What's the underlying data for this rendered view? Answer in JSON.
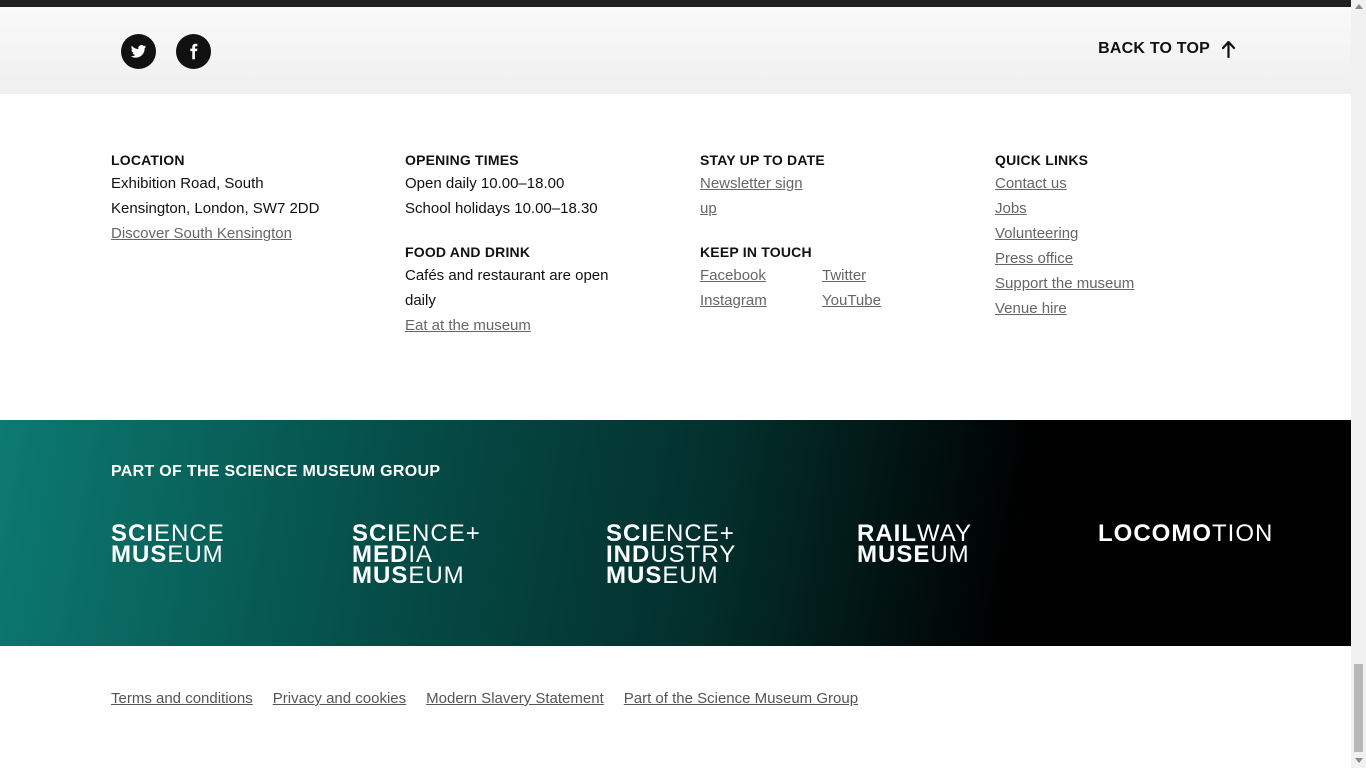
{
  "social": {
    "twitter_icon": "twitter-icon",
    "facebook_icon": "facebook-icon",
    "back_to_top": "BACK TO TOP"
  },
  "location": {
    "heading": "LOCATION",
    "line1": "Exhibition Road, South",
    "line2": "Kensington, London, SW7 2DD",
    "link": "Discover South Kensington"
  },
  "opening": {
    "heading": "OPENING TIMES",
    "line1": "Open daily 10.00–18.00",
    "line2": "School holidays 10.00–18.30",
    "food_heading": "FOOD AND DRINK",
    "food_line1": "Cafés and restaurant are open",
    "food_line2": "daily",
    "food_link": "Eat at the museum"
  },
  "stay": {
    "heading": "STAY UP TO DATE",
    "newsletter_line1": "Newsletter sign",
    "newsletter_line2": "up",
    "keep_heading": "KEEP IN TOUCH",
    "facebook": "Facebook",
    "twitter": "Twitter",
    "instagram": "Instagram",
    "youtube": "YouTube"
  },
  "quick": {
    "heading": "QUICK LINKS",
    "links": [
      "Contact us",
      "Jobs",
      "Volunteering",
      "Press office",
      "Support the museum",
      "Venue hire"
    ]
  },
  "group": {
    "heading": "PART OF THE SCIENCE MUSEUM GROUP",
    "science_museum": [
      "SCIENCE",
      "MUSEUM"
    ],
    "media_museum": [
      "SCIENCE+",
      "MEDIA",
      "MUSEUM"
    ],
    "industry_museum": [
      "SCIENCE+",
      "INDUSTRY",
      "MUSEUM"
    ],
    "railway_museum": [
      "RAILWAY",
      "MUSEUM"
    ],
    "locomotion": "LOCOMOTION"
  },
  "legal": {
    "links": [
      "Terms and conditions",
      "Privacy and cookies",
      "Modern Slavery Statement",
      "Part of the Science Museum Group"
    ]
  },
  "colors": {
    "group_gradient_start": "#0c7a71",
    "group_gradient_end": "#000000",
    "link_grey": "#666666"
  }
}
